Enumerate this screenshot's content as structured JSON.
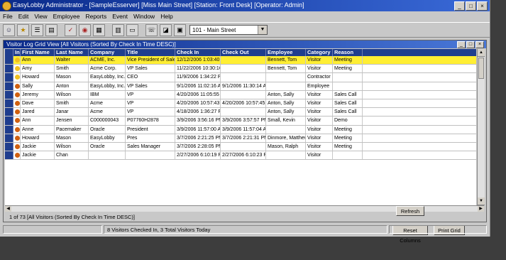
{
  "window": {
    "title": "EasyLobby Administrator - [SampleEsserver] [Miss Main Street] [Station: Front Desk] [Operator: Admin]",
    "controls": [
      "_",
      "□",
      "×"
    ]
  },
  "menu": [
    "File",
    "Edit",
    "View",
    "Employee",
    "Reports",
    "Event",
    "Window",
    "Help"
  ],
  "toolbar": {
    "icons": [
      "user-icon",
      "badge-icon",
      "list-icon",
      "card-icon",
      "sign-in-icon",
      "camera-icon",
      "report-icon",
      "print-icon",
      "video-icon",
      "phone-icon",
      "id-icon",
      "settings-icon"
    ],
    "location_select": "101 - Main Street"
  },
  "inner_window": {
    "title": "Visitor Log    Grid View [All Visitors (Sorted By Check In Time DESC)]",
    "controls": [
      "_",
      "□",
      "×"
    ]
  },
  "grid": {
    "columns": [
      "",
      "In",
      "First Name",
      "Last Name",
      "Company",
      "Title",
      "Check In",
      "Check Out",
      "Employee",
      "Category",
      "Reason"
    ],
    "rows": [
      {
        "status": "yellow",
        "first": "Ann",
        "last": "Walter",
        "company": "ACME, Inc.",
        "title": "Vice President of Sales",
        "checkin": "12/12/2006 1:03:40 PM",
        "checkout": "",
        "employee": "Bennett, Tom",
        "category": "Visitor",
        "reason": "Meeting"
      },
      {
        "status": "yellow",
        "first": "Amy",
        "last": "Smith",
        "company": "Acme Corp.",
        "title": "VP Sales",
        "checkin": "11/22/2006 10:30:16 AM",
        "checkout": "",
        "employee": "Bennett, Tom",
        "category": "Visitor",
        "reason": "Meeting"
      },
      {
        "status": "yellow",
        "first": "Howard",
        "last": "Mason",
        "company": "EasyLobby, Inc.",
        "title": "CEO",
        "checkin": "11/9/2006 1:34:22 PM",
        "checkout": "",
        "employee": "",
        "category": "Contractor",
        "reason": ""
      },
      {
        "status": "orange",
        "first": "Sally",
        "last": "Anton",
        "company": "EasyLobby, Inc.",
        "title": "VP Sales",
        "checkin": "9/1/2006 11:02:16 AM",
        "checkout": "9/1/2006 11:30:14 AM",
        "employee": "",
        "category": "Employee",
        "reason": ""
      },
      {
        "status": "orange",
        "first": "Jeremy",
        "last": "Wilson",
        "company": "IBM",
        "title": "VP",
        "checkin": "4/20/2006 11:05:55 AM",
        "checkout": "",
        "employee": "Anton, Sally",
        "category": "Visitor",
        "reason": "Sales Call"
      },
      {
        "status": "orange",
        "first": "Dave",
        "last": "Smith",
        "company": "Acme",
        "title": "VP",
        "checkin": "4/20/2006 10:57:43 AM",
        "checkout": "4/20/2006 10:57:45 AM",
        "employee": "Anton, Sally",
        "category": "Visitor",
        "reason": "Sales Call"
      },
      {
        "status": "orange",
        "first": "Jared",
        "last": "Janar",
        "company": "Acme",
        "title": "VP",
        "checkin": "4/18/2006 1:36:27 PM",
        "checkout": "",
        "employee": "Anton, Sally",
        "category": "Visitor",
        "reason": "Sales Call"
      },
      {
        "status": "orange",
        "first": "Ann",
        "last": "Jensen",
        "company": "C000000043",
        "title": "P07760H2878",
        "checkin": "3/9/2006 3:56:16 PM",
        "checkout": "3/9/2006 3:57:57 PM",
        "employee": "Small, Kevin",
        "category": "Visitor",
        "reason": "Demo"
      },
      {
        "status": "orange",
        "first": "Anne",
        "last": "Pacemaker",
        "company": "Oracle",
        "title": "President",
        "checkin": "3/9/2006 11:57:00 AM",
        "checkout": "3/9/2006 11:57:04 AM",
        "employee": "",
        "category": "Visitor",
        "reason": "Meeting"
      },
      {
        "status": "orange",
        "first": "Howard",
        "last": "Mason",
        "company": "EasyLobby",
        "title": "Pres",
        "checkin": "3/7/2006 2:21:25 PM",
        "checkout": "3/7/2006 2:21:31 PM",
        "employee": "Dinmore, Matthew",
        "category": "Visitor",
        "reason": "Meeting"
      },
      {
        "status": "orange",
        "first": "Jackie",
        "last": "Wilson",
        "company": "Oracle",
        "title": "Sales Manager",
        "checkin": "3/7/2006 2:28:05 PM",
        "checkout": "",
        "employee": "Mason, Ralph",
        "category": "Visitor",
        "reason": "Meeting"
      },
      {
        "status": "orange",
        "first": "Jackie",
        "last": "Chan",
        "company": "",
        "title": "",
        "checkin": "2/27/2006 6:10:19 PM",
        "checkout": "2/27/2006 6:10:23 PM",
        "employee": "",
        "category": "Visitor",
        "reason": ""
      }
    ]
  },
  "status_line": "1 of 73 [All Visitors (Sorted By Check In Time DESC)]",
  "buttons": {
    "reset_columns": "Reset Columns",
    "print_grid": "Print Grid",
    "refresh": "Refresh"
  },
  "statusbar": {
    "panels": [
      "",
      "8 Visitors Checked In, 3 Total Visitors Today",
      ""
    ]
  },
  "colors": {
    "title_blue": "#0a2a8a",
    "header_blue": "#1f3e8e",
    "highlight_row": "#ffee33",
    "status_yellow": "#f0c020",
    "status_orange": "#d06010"
  }
}
